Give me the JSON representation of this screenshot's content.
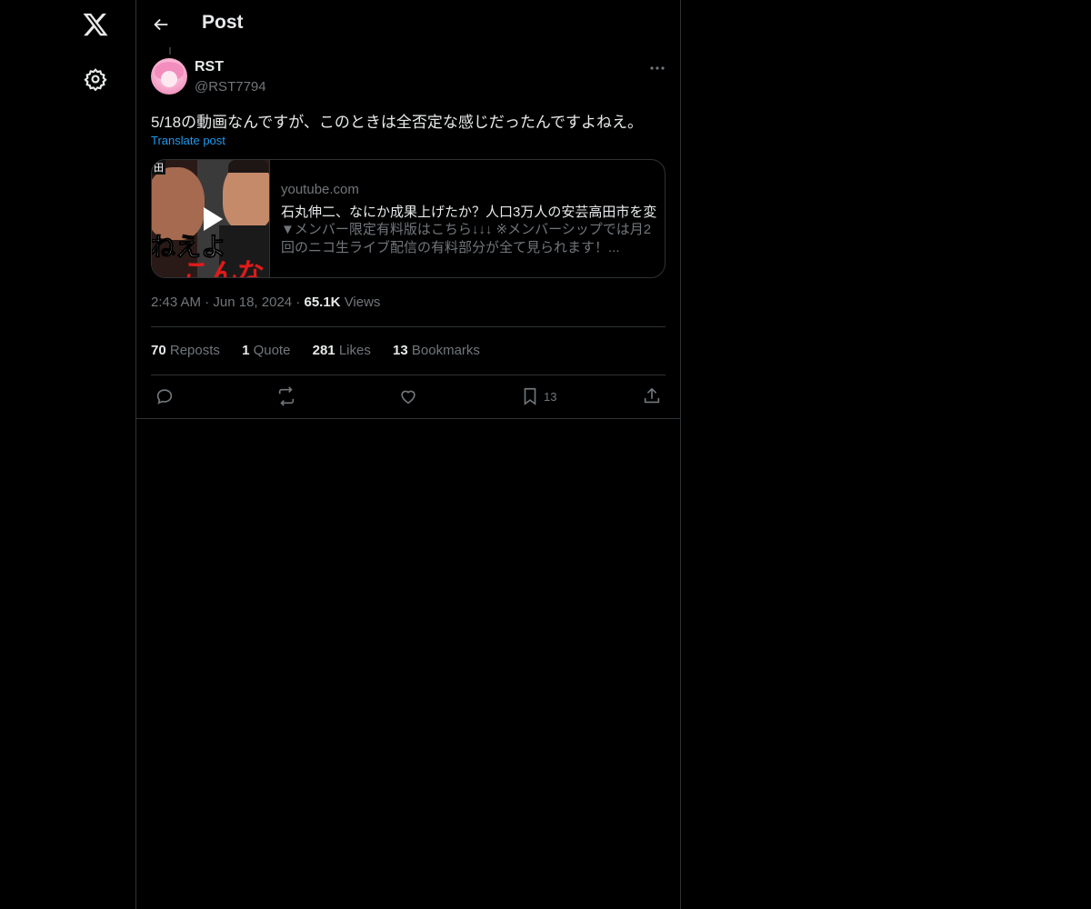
{
  "header": {
    "title": "Post"
  },
  "post": {
    "display_name": "RST",
    "handle": "@RST7794",
    "text": "5/18の動画なんですが、このときは全否定な感じだったんですよねえ。",
    "translate_label": "Translate post",
    "card": {
      "domain": "youtube.com",
      "title": "石丸伸二、なにか成果上げたか？人口3万人の安芸高田市を変",
      "description": "▼メンバー限定有料版はこちら↓↓↓ ※メンバーシップでは月2回のニコ生ライブ配信の有料部分が全て見られます！...",
      "thumb_text_top": "ねえよ",
      "thumb_text_bottom": "こんな",
      "thumb_tag": "田"
    },
    "time": "2:43 AM",
    "date": "Jun 18, 2024",
    "views_count": "65.1K",
    "views_label": "Views",
    "separator": "·"
  },
  "stats": {
    "reposts_count": "70",
    "reposts_label": "Reposts",
    "quotes_count": "1",
    "quotes_label": "Quote",
    "likes_count": "281",
    "likes_label": "Likes",
    "bookmarks_count": "13",
    "bookmarks_label": "Bookmarks"
  },
  "actions": {
    "bookmark_count": "13"
  },
  "icons": [
    "x-logo-icon",
    "gear-icon",
    "back-arrow-icon",
    "more-icon",
    "play-icon",
    "reply-icon",
    "repost-icon",
    "like-icon",
    "bookmark-icon",
    "share-icon"
  ],
  "colors": {
    "background": "#000000",
    "text": "#e7e9ea",
    "secondary": "#71767b",
    "link": "#1d9bf0",
    "border": "#2f3336"
  }
}
